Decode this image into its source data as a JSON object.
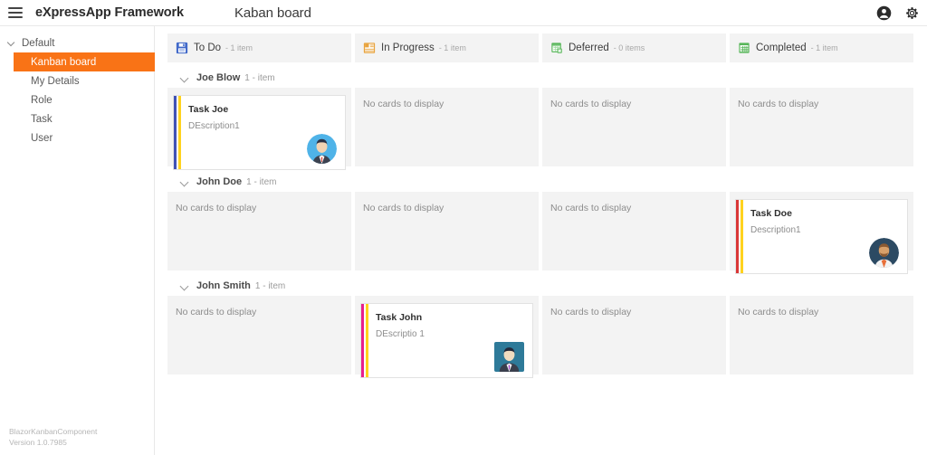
{
  "topbar": {
    "menu_icon": "hamburger-icon",
    "brand": "eXpressApp Framework",
    "page_title": "Kaban board",
    "account_icon": "account-circle-icon",
    "settings_icon": "gear-icon"
  },
  "sidebar": {
    "group_label": "Default",
    "items": [
      {
        "label": "Kanban board",
        "active": true
      },
      {
        "label": "My Details",
        "active": false
      },
      {
        "label": "Role",
        "active": false
      },
      {
        "label": "Task",
        "active": false
      },
      {
        "label": "User",
        "active": false
      }
    ],
    "footer": {
      "component": "BlazorKanbanComponent",
      "version": "Version 1.0.7985"
    },
    "accent_color": "#f97316"
  },
  "board": {
    "empty_cell_text": "No cards to display",
    "columns": [
      {
        "name": "To Do",
        "count_label": "- 1 item",
        "icon": "save-floppy-icon",
        "icon_color": "#4169c9"
      },
      {
        "name": "In Progress",
        "count_label": "- 1 item",
        "icon": "in-progress-icon",
        "icon_color": "#e8a33d"
      },
      {
        "name": "Deferred",
        "count_label": "- 0 items",
        "icon": "deferred-grid-icon",
        "icon_color": "#58b65a"
      },
      {
        "name": "Completed",
        "count_label": "- 1 item",
        "icon": "completed-grid-icon",
        "icon_color": "#58b65a"
      }
    ],
    "swimlanes": [
      {
        "name": "Joe Blow",
        "count_label": "1 - item",
        "cells": [
          {
            "card": {
              "title": "Task Joe",
              "description": "DEscription1",
              "stripe_a": "#3f51b5",
              "stripe_b": "#ffd21e",
              "avatar": {
                "shape": "round",
                "name": "avatar-joe-blow",
                "bg": "#4fb3e8",
                "skin": "#f2d3b3",
                "hair": "#2b3246",
                "suit": "#3c4250",
                "accent": "#d94a3d"
              }
            }
          },
          {
            "card": null
          },
          {
            "card": null
          },
          {
            "card": null
          }
        ]
      },
      {
        "name": "John Doe",
        "count_label": "1 - item",
        "cells": [
          {
            "card": null
          },
          {
            "card": null
          },
          {
            "card": null
          },
          {
            "card": {
              "title": "Task Doe",
              "description": "Description1",
              "stripe_a": "#d93636",
              "stripe_b": "#ffd21e",
              "avatar": {
                "shape": "round",
                "name": "avatar-john-doe",
                "bg": "#2c4a63",
                "skin": "#d7a06a",
                "hair": "#8a5a32",
                "suit": "#f2f2f2",
                "accent": "#e8703a"
              }
            }
          }
        ]
      },
      {
        "name": "John Smith",
        "count_label": "1 - item",
        "cells": [
          {
            "card": null
          },
          {
            "card": {
              "title": "Task John",
              "description": "DEscriptio 1",
              "stripe_a": "#e91e8c",
              "stripe_b": "#ffd21e",
              "avatar": {
                "shape": "square",
                "name": "avatar-john-smith",
                "bg": "#2e7a99",
                "skin": "#f0dcc0",
                "hair": "#23283a",
                "suit": "#3a3f4d",
                "accent": "#9b3fc4"
              }
            }
          },
          {
            "card": null
          },
          {
            "card": null
          }
        ]
      }
    ]
  }
}
